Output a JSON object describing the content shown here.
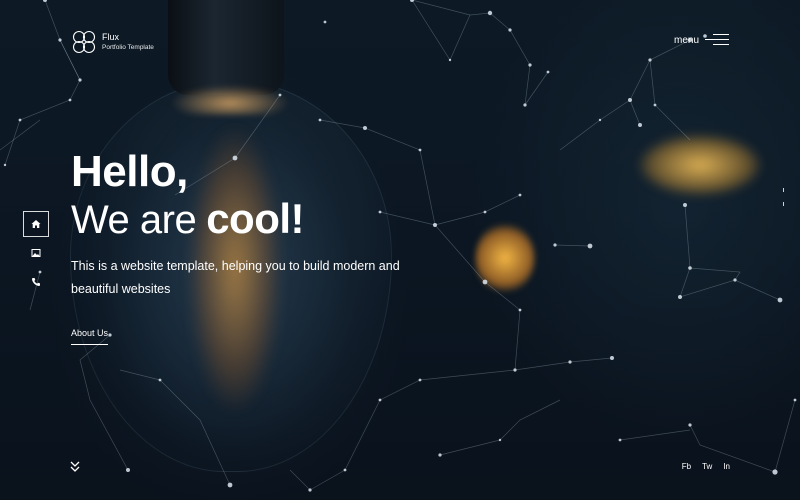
{
  "brand": {
    "name": "Flux",
    "subtitle": "Portfolio Template",
    "icon": "flux-logo-icon"
  },
  "header": {
    "menu_label": "menu",
    "menu_icon": "hamburger-icon"
  },
  "sidenav": {
    "items": [
      {
        "name": "home",
        "icon": "home-icon",
        "active": true
      },
      {
        "name": "gallery",
        "icon": "image-icon",
        "active": false
      },
      {
        "name": "contact",
        "icon": "phone-icon",
        "active": false
      }
    ]
  },
  "hero": {
    "line1": "Hello,",
    "line2_prefix": "We are",
    "line2_emphasis": "cool!",
    "description": "This is a website template, helping you to build modern and beautiful websites",
    "cta_label": "About Us"
  },
  "scroll": {
    "icon": "double-chevron-down-icon"
  },
  "social": {
    "links": [
      "Fb",
      "Tw",
      "In"
    ]
  },
  "colors": {
    "background": "#0b1420",
    "text": "#ffffff",
    "glow": "#ffb446"
  }
}
